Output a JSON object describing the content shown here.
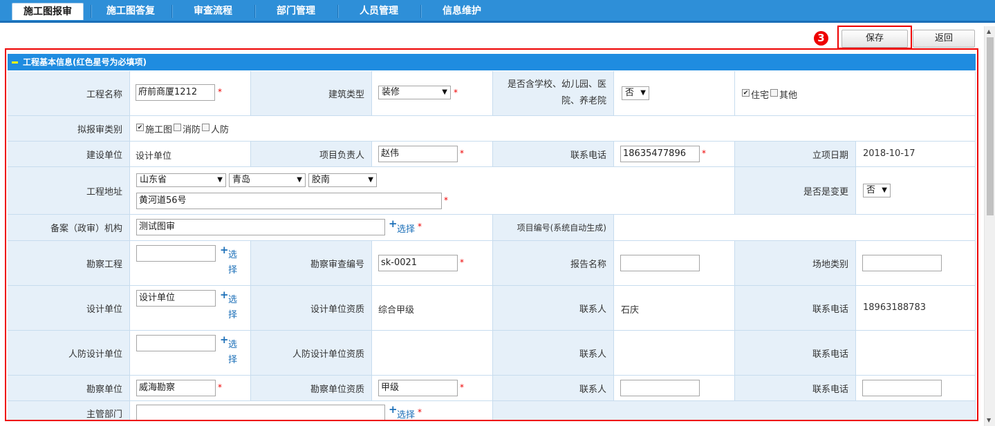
{
  "nav": {
    "tabs": [
      "施工图报审",
      "施工图答复",
      "审查流程",
      "部门管理",
      "人员管理",
      "信息维护"
    ],
    "active_index": 0
  },
  "toolbar": {
    "save_label": "保存",
    "back_label": "返回",
    "step_badge": "3"
  },
  "panel": {
    "title": "工程基本信息(红色星号为必填项)"
  },
  "form": {
    "project_name": {
      "label": "工程名称",
      "value": "府前商厦1212"
    },
    "building_type": {
      "label": "建筑类型",
      "value": "装修"
    },
    "includes_school": {
      "label": "是否含学校、幼儿园、医院、养老院",
      "value": "否"
    },
    "usage": {
      "opt1": "住宅",
      "opt2": "其他"
    },
    "review_category": {
      "label": "拟报审类别",
      "opt1": "施工图",
      "opt2": "消防",
      "opt3": "人防"
    },
    "construction_unit": {
      "label": "建设单位",
      "value": "设计单位"
    },
    "project_leader": {
      "label": "项目负责人",
      "value": "赵伟"
    },
    "contact_phone": {
      "label": "联系电话",
      "value": "18635477896"
    },
    "approval_date": {
      "label": "立项日期",
      "value": "2018-10-17"
    },
    "address": {
      "label": "工程地址",
      "province": "山东省",
      "city": "青岛",
      "district": "胶南",
      "street": "黄河道56号"
    },
    "is_changed": {
      "label": "是否是变更",
      "value": "否"
    },
    "review_agency": {
      "label": "备案（政审）机构",
      "value": "测试图审",
      "select": "选择"
    },
    "project_no": {
      "label": "项目编号(系统自动生成)"
    },
    "survey_project": {
      "label": "勘察工程",
      "value": "",
      "select": "选择"
    },
    "survey_review_no": {
      "label": "勘察审查编号",
      "value": "sk-0021"
    },
    "report_name": {
      "label": "报告名称",
      "value": ""
    },
    "site_category": {
      "label": "场地类别",
      "value": ""
    },
    "design_unit": {
      "label": "设计单位",
      "value": "设计单位",
      "select": "选择"
    },
    "design_unit_qual": {
      "label": "设计单位资质",
      "value": "综合甲级"
    },
    "design_contact": {
      "label": "联系人",
      "value": "石庆"
    },
    "design_phone": {
      "label": "联系电话",
      "value": "18963188783"
    },
    "cd_design_unit": {
      "label": "人防设计单位",
      "value": "",
      "select": "选择"
    },
    "cd_design_qual": {
      "label": "人防设计单位资质",
      "value": ""
    },
    "cd_contact": {
      "label": "联系人",
      "value": ""
    },
    "cd_phone": {
      "label": "联系电话",
      "value": ""
    },
    "survey_unit": {
      "label": "勘察单位",
      "value": "威海勘察"
    },
    "survey_unit_qual": {
      "label": "勘察单位资质",
      "value": "甲级"
    },
    "survey_contact": {
      "label": "联系人",
      "value": ""
    },
    "survey_phone": {
      "label": "联系电话",
      "value": ""
    },
    "authority": {
      "label": "主管部门",
      "value": "",
      "select": "选择"
    }
  },
  "required_mark": "*"
}
